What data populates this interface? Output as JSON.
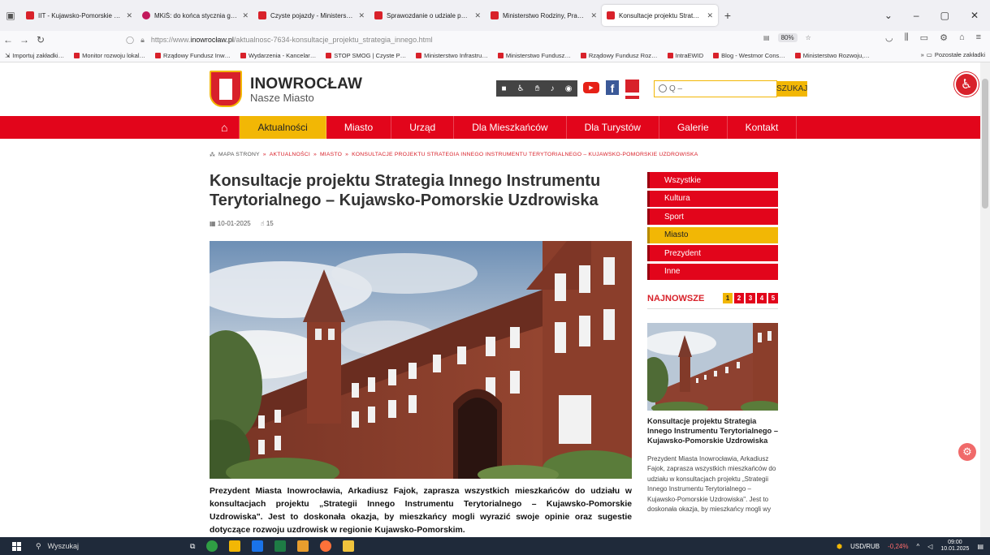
{
  "browser": {
    "tabs": [
      {
        "label": "IIT - Kujawsko-Pomorskie Uzdr…",
        "active": false
      },
      {
        "label": "MKiŚ: do końca stycznia gminy…",
        "active": false
      },
      {
        "label": "Czyste pojazdy - Ministerstwo I…",
        "active": false
      },
      {
        "label": "Sprawozdanie o udziale pojazd…",
        "active": false
      },
      {
        "label": "Ministerstwo Rodziny, Pracy i P…",
        "active": false
      },
      {
        "label": "Konsultacje projektu Strategia I…",
        "active": true
      }
    ],
    "url_prefix": "https://www.",
    "url_host": "inowrocław.pl",
    "url_path": "/aktualnosc-7634-konsultacje_projektu_strategia_innego.html",
    "zoom": "80%",
    "bookmarks": [
      "Importuj zakładki…",
      "Monitor rozwoju lokal…",
      "Rządowy Fundusz Inw…",
      "Wydarzenia - Kancelar…",
      "STOP SMOG | Czyste P…",
      "Ministerstwo Infrastru…",
      "Ministerstwo Fundusz…",
      "Rządowy Fundusz Roz…",
      "IntraEWID",
      "Blog - Westmor Cons…",
      "Ministerstwo Rozwoju,…"
    ],
    "bookmarks_other": "Pozostałe zakładki"
  },
  "site": {
    "name": "INOWROCŁAW",
    "tagline": "Nasze Miasto",
    "search_placeholder": "Q –",
    "search_button": "SZUKAJ",
    "colors": {
      "red": "#e2051b",
      "yellow": "#f2b705"
    }
  },
  "nav": {
    "home_icon": "home-icon",
    "items": [
      "Aktualności",
      "Miasto",
      "Urząd",
      "Dla Mieszkańców",
      "Dla Turystów",
      "Galerie",
      "Kontakt"
    ],
    "active": "Aktualności"
  },
  "breadcrumb": {
    "sitemap": "MAPA STRONY",
    "items": [
      "AKTUALNOŚCI",
      "MIASTO",
      "KONSULTACJE PROJEKTU STRATEGIA INNEGO INSTRUMENTU TERYTORIALNEGO – KUJAWSKO-POMORSKIE UZDROWISKA"
    ],
    "separator": "»"
  },
  "article": {
    "title": "Konsultacje projektu Strategia Innego Instrumentu Terytorialnego – Kujawsko-Pomorskie Uzdrowiska",
    "date": "10-01-2025",
    "views": "15",
    "lead": "Prezydent Miasta Inowrocławia, Arkadiusz Fajok, zaprasza wszystkich mieszkańców do udziału w konsultacjach projektu „Strategii Innego Instrumentu Terytorialnego – Kujawsko-Pomorskie Uzdrowiska\". Jest to doskonała okazja, by mieszkańcy mogli wyrazić swoje opinie oraz sugestie dotyczące rozwoju uzdrowisk w regionie Kujawsko-Pomorskim."
  },
  "sidebar": {
    "categories": [
      "Wszystkie",
      "Kultura",
      "Sport",
      "Miasto",
      "Prezydent",
      "Inne"
    ],
    "active_category": "Miasto",
    "newest_label": "NAJNOWSZE",
    "pages": [
      "1",
      "2",
      "3",
      "4",
      "5"
    ],
    "active_page": "1",
    "featured_title": "Konsultacje projektu Strategia Innego Instrumentu Terytorialnego – Kujawsko-Pomorskie Uzdrowiska",
    "featured_excerpt": "Prezydent Miasta Inowrocławia, Arkadiusz Fajok, zaprasza wszystkich mieszkańców do udziału w konsultacjach projektu „Strategii Innego Instrumentu Terytorialnego – Kujawsko-Pomorskie Uzdrowiska\". Jest to doskonała okazja, by mieszkańcy mogli wy"
  },
  "taskbar": {
    "search_label": "Wyszukaj",
    "ticker_label": "USD/RUB",
    "ticker_value": "-0,24%",
    "time": "09:00",
    "date": "10.01.2025"
  }
}
